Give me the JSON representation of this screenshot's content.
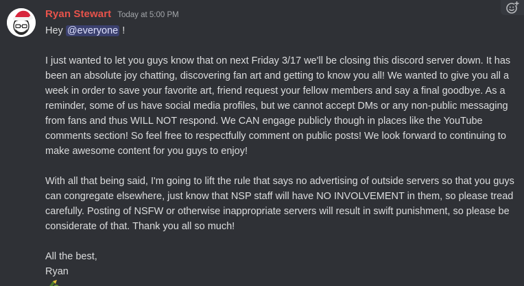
{
  "message": {
    "author": {
      "name": "Ryan Stewart",
      "name_color": "#e8534b",
      "avatar_icon": "santa-hat-avatar-icon"
    },
    "timestamp": "Today at 5:00 PM",
    "greeting_prefix": "Hey ",
    "mention": "@everyone",
    "greeting_suffix": " !",
    "paragraphs": [
      "I just wanted to let you guys know that on next Friday 3/17 we'll be closing this discord server down. It has been an absolute joy chatting, discovering fan art and getting to know you all! We wanted to give you all a week in order to save your favorite art, friend request your fellow members and say a final goodbye. As a reminder, some of us have social media profiles, but we cannot accept DMs or any non-public messaging from fans and thus WILL NOT respond. We CAN engage publicly though in places like the YouTube comments section! So feel free to respectfully comment on public posts! We look forward to continuing to make awesome content for you guys to enjoy!",
      "With all that being said, I'm going to lift the rule that says no advertising of outside servers so that you guys can congregate elsewhere, just know that NSP staff will have NO INVOLVEMENT in them, so please tread carefully. Posting of NSFW or otherwise inappropriate servers will result in swift punishment, so please be considerate of that. Thank you all so much!"
    ],
    "signoff": "All the best,",
    "signature": "Ryan"
  },
  "toolbar": {
    "add_reaction_icon": "add-reaction-icon"
  },
  "colors": {
    "background": "#2f3136",
    "text": "#dcddde",
    "mention_bg": "#4a4f9a",
    "timestamp": "#a3a6aa"
  }
}
